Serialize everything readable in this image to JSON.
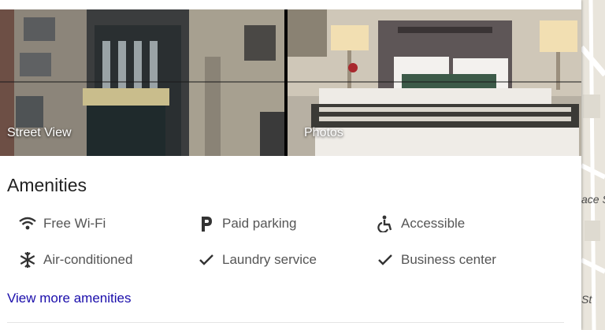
{
  "photos": {
    "street_view_label": "Street View",
    "photos_label": "Photos"
  },
  "amenities": {
    "title": "Amenities",
    "items": [
      {
        "icon": "wifi-icon",
        "label": "Free Wi-Fi"
      },
      {
        "icon": "parking-icon",
        "label": "Paid parking"
      },
      {
        "icon": "accessible-icon",
        "label": "Accessible"
      },
      {
        "icon": "snowflake-icon",
        "label": "Air-conditioned"
      },
      {
        "icon": "checkmark-icon",
        "label": "Laundry service"
      },
      {
        "icon": "checkmark-icon",
        "label": "Business center"
      }
    ],
    "more_link": "View more amenities"
  },
  "map": {
    "labels": [
      "ace S",
      "St"
    ]
  },
  "colors": {
    "link": "#1a0dab",
    "title": "#222222",
    "item_text": "#555555",
    "map_bg": "#e9e5dc"
  }
}
